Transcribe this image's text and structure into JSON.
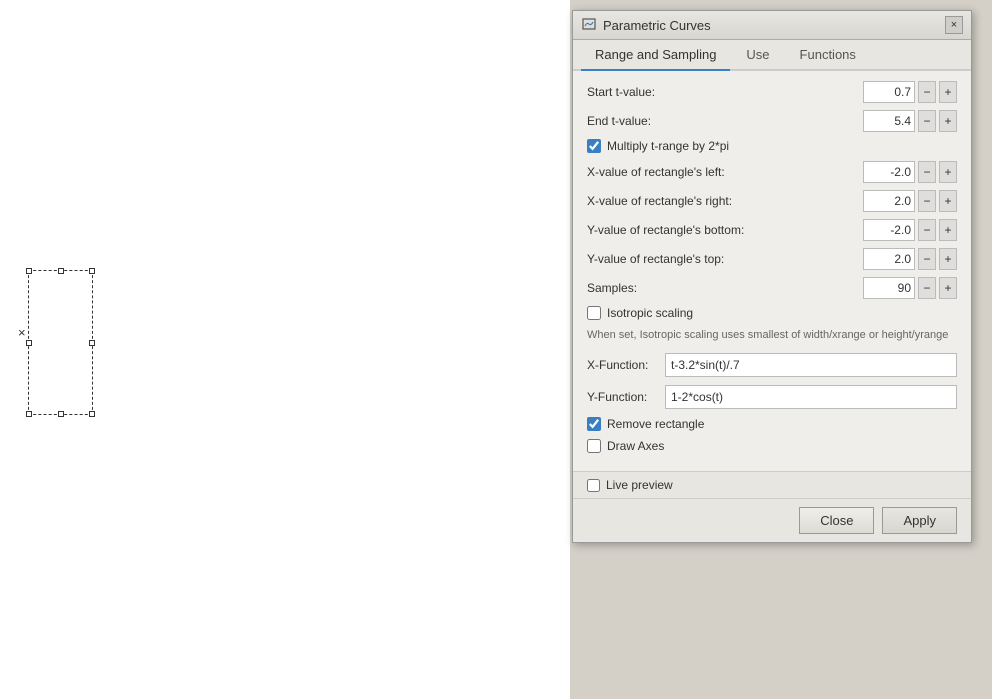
{
  "canvas": {
    "x_mark": "×"
  },
  "dialog": {
    "title": "Parametric Curves",
    "close_label": "×",
    "tabs": [
      {
        "id": "range",
        "label": "Range and Sampling",
        "active": true
      },
      {
        "id": "use",
        "label": "Use",
        "active": false
      },
      {
        "id": "functions",
        "label": "Functions",
        "active": false
      }
    ],
    "fields": {
      "start_t_label": "Start t-value:",
      "start_t_value": "0.7",
      "end_t_label": "End t-value:",
      "end_t_value": "5.4",
      "multiply_label": "Multiply t-range by 2*pi",
      "rect_left_label": "X-value of rectangle's left:",
      "rect_left_value": "-2.0",
      "rect_right_label": "X-value of rectangle's right:",
      "rect_right_value": "2.0",
      "rect_bottom_label": "Y-value of rectangle's bottom:",
      "rect_bottom_value": "-2.0",
      "rect_top_label": "Y-value of rectangle's top:",
      "rect_top_value": "2.0",
      "samples_label": "Samples:",
      "samples_value": "90",
      "isotropic_label": "Isotropic scaling",
      "hint_text": "When set, Isotropic scaling uses smallest of width/xrange or height/yrange",
      "x_function_label": "X-Function:",
      "x_function_value": "t-3.2*sin(t)/.7",
      "y_function_label": "Y-Function:",
      "y_function_value": "1-2*cos(t)",
      "remove_rect_label": "Remove rectangle",
      "draw_axes_label": "Draw Axes",
      "live_preview_label": "Live preview"
    },
    "footer": {
      "close_label": "Close",
      "apply_label": "Apply"
    },
    "checkboxes": {
      "multiply_checked": true,
      "isotropic_checked": false,
      "remove_rect_checked": true,
      "draw_axes_checked": false,
      "live_preview_checked": false
    }
  }
}
